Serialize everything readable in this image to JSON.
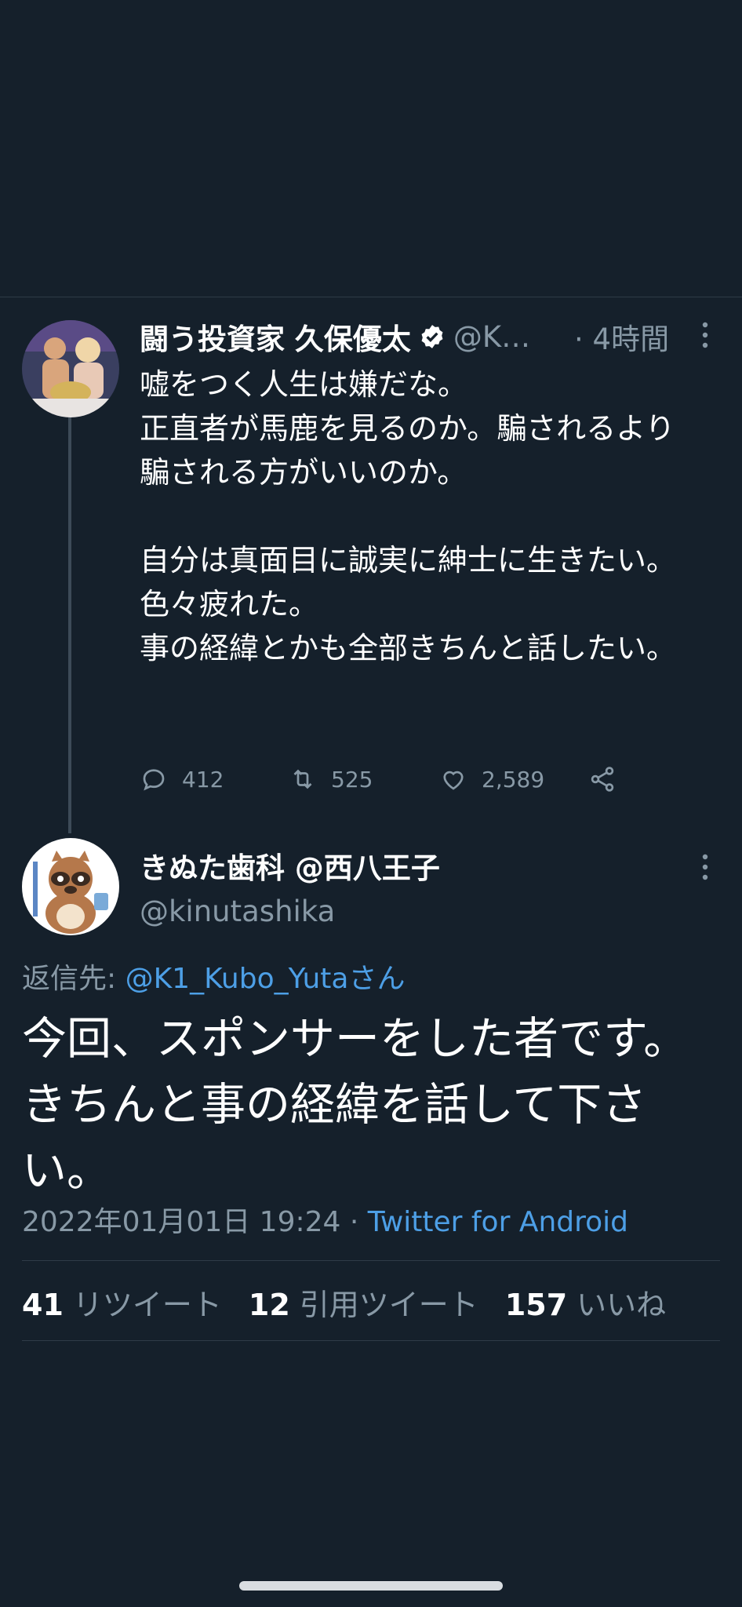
{
  "original_tweet": {
    "display_name": "闘う投資家 久保優太",
    "handle": "@K…",
    "time": "· 4時間",
    "text": "嘘をつく人生は嫌だな。\n正直者が馬鹿を見るのか。騙されるより騙される方がいいのか。\n\n自分は真面目に誠実に紳士に生きたい。\n色々疲れた。\n事の経緯とかも全部きちんと話したい。",
    "stats": {
      "replies": "412",
      "retweets": "525",
      "likes": "2,589"
    }
  },
  "reply_tweet": {
    "display_name": "きぬた歯科 @西八王子",
    "handle": "@kinutashika",
    "reply_to_prefix": "返信先: ",
    "reply_to_user": "@K1_Kubo_Yutaさん",
    "text": "今回、スポンサーをした者です。きちんと事の経緯を話して下さい。",
    "timestamp": "2022年01月01日 19:24",
    "separator": " · ",
    "source": "Twitter for Android",
    "retweet_count": "41",
    "retweet_label": "リツイート",
    "quote_count": "12",
    "quote_label": "引用ツイート",
    "like_count": "157",
    "like_label": "いいね"
  },
  "icons": {
    "verified": "verified-badge-icon",
    "more": "more-vertical-icon",
    "reply": "comment-icon",
    "retweet": "retweet-icon",
    "like": "heart-icon",
    "share": "share-icon"
  },
  "colors": {
    "background": "#15202b",
    "link": "#4d9fe6",
    "muted": "#8899a6"
  }
}
